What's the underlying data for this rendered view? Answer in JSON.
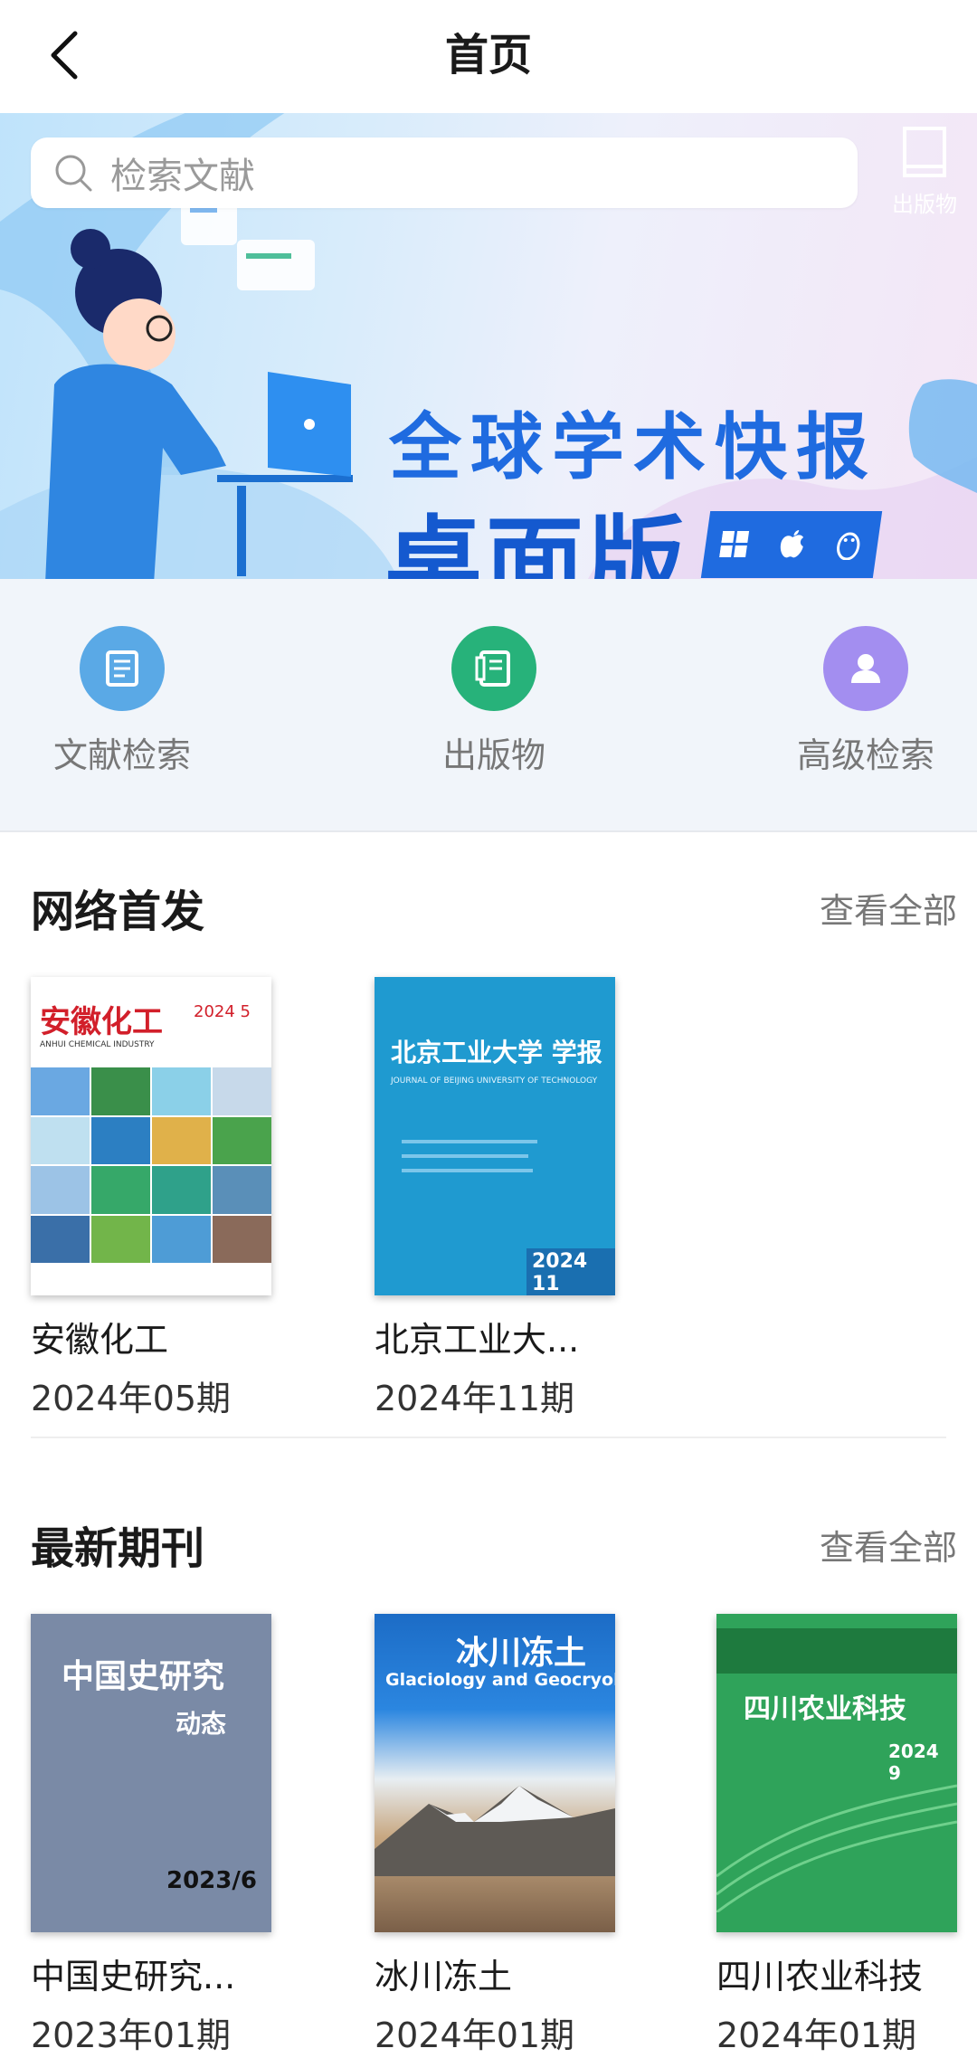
{
  "header": {
    "title": "首页",
    "back_icon": "back-arrow-icon"
  },
  "search": {
    "placeholder": "检索文献"
  },
  "publication_shortcut": {
    "label": "出版物"
  },
  "banner": {
    "line1": "全球学术快报",
    "line2": "桌面版",
    "platforms": [
      "windows-icon",
      "apple-icon",
      "linux-icon"
    ]
  },
  "quick_actions": [
    {
      "label": "文献检索",
      "icon": "document-icon",
      "color": "#5aa9e6"
    },
    {
      "label": "出版物",
      "icon": "publication-icon",
      "color": "#27b27a"
    },
    {
      "label": "高级检索",
      "icon": "person-icon",
      "color": "#a38ef0"
    }
  ],
  "online_first": {
    "title": "网络首发",
    "see_all": "查看全部",
    "items": [
      {
        "name": "安徽化工",
        "issue": "2024年05期",
        "cover_title": "安徽化工",
        "cover_sub": "ANHUI CHEMICAL INDUSTRY",
        "cover_issue": "2024 5"
      },
      {
        "name": "北京工业大...",
        "issue": "2024年11期",
        "cover_title": "北京工业大学 学报",
        "cover_sub": "JOURNAL OF BEIJING UNIVERSITY OF TECHNOLOGY",
        "cover_issue": "2024 11"
      }
    ]
  },
  "latest": {
    "title": "最新期刊",
    "see_all": "查看全部",
    "items": [
      {
        "name": "中国史研究...",
        "issue": "2023年01期",
        "cover_title": "中国史研究",
        "cover_sub": "动态",
        "cover_issue": "2023/6"
      },
      {
        "name": "冰川冻土",
        "issue": "2024年01期",
        "cover_title": "冰川冻土",
        "cover_sub": "Glaciology and Geocryology"
      },
      {
        "name": "四川农业科技",
        "issue": "2024年01期",
        "cover_title": "四川农业科技",
        "cover_issue": "2024 9"
      }
    ]
  },
  "colors": {
    "brand_blue": "#1f6be0",
    "muted_text": "#777777"
  }
}
